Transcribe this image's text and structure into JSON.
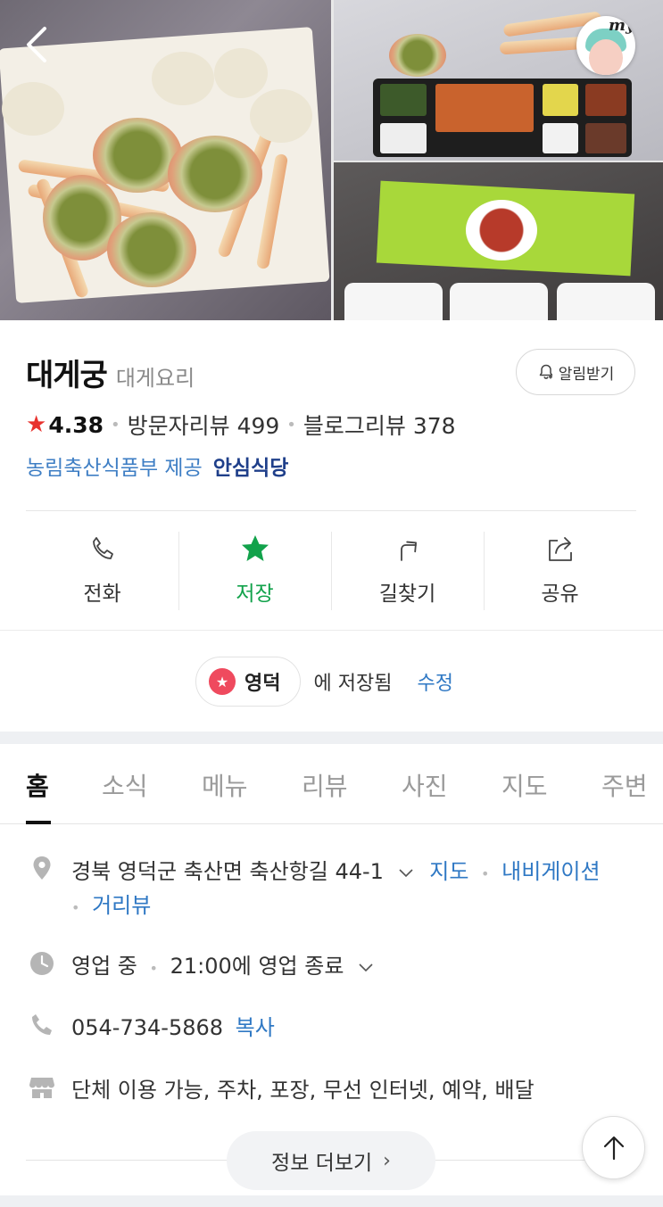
{
  "place": {
    "name": "대게궁",
    "category": "대게요리",
    "alarm_label": "알림받기",
    "rating": "4.38",
    "visitor_reviews": "방문자리뷰 499",
    "blog_reviews": "블로그리뷰 378",
    "cert_provider": "농림축산식품부 제공",
    "cert_name": "안심식당"
  },
  "actions": [
    {
      "label": "전화",
      "icon": "phone-icon"
    },
    {
      "label": "저장",
      "icon": "star-icon",
      "state": "saved",
      "color": "#12a24b"
    },
    {
      "label": "길찾기",
      "icon": "directions-icon"
    },
    {
      "label": "공유",
      "icon": "share-icon"
    }
  ],
  "saved": {
    "folder": "영덕",
    "status": "에 저장됨",
    "edit": "수정"
  },
  "tabs": [
    {
      "label": "홈",
      "active": true
    },
    {
      "label": "소식"
    },
    {
      "label": "메뉴"
    },
    {
      "label": "리뷰"
    },
    {
      "label": "사진"
    },
    {
      "label": "지도"
    },
    {
      "label": "주변"
    }
  ],
  "info": {
    "address": "경북 영덕군 축산면 축산항길 44-1",
    "map_link": "지도",
    "navigation_link": "내비게이션",
    "street_view_link": "거리뷰",
    "open_status": "영업 중",
    "hours": "21:00에 영업 종료",
    "phone": "054-734-5868",
    "copy_label": "복사",
    "facilities": "단체 이용 가능, 주차, 포장, 무선 인터넷, 예약, 배달"
  },
  "more_label": "정보 더보기",
  "my_badge": "my",
  "colors": {
    "link": "#2f78c4",
    "saved_green": "#12a24b",
    "rating_star": "#e8322e",
    "chip_red": "#ef4a5e"
  }
}
